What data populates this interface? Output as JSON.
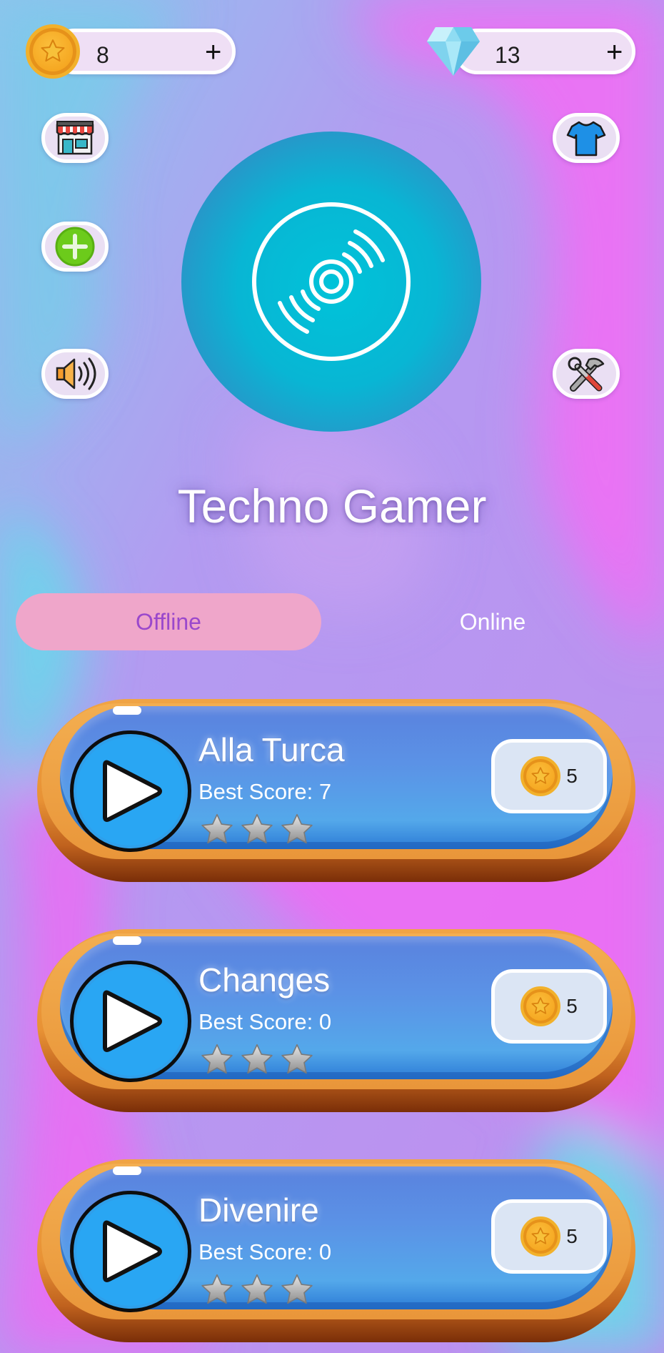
{
  "currency": {
    "coins": {
      "value": "8",
      "add_label": "+"
    },
    "gems": {
      "value": "13",
      "add_label": "+"
    }
  },
  "side_buttons": {
    "left": [
      "shop-icon",
      "add-icon",
      "speaker-icon"
    ],
    "right": [
      "shirt-icon",
      "tools-icon"
    ]
  },
  "player_name": "Techno Gamer",
  "tabs": [
    {
      "label": "Offline",
      "active": true
    },
    {
      "label": "Online",
      "active": false
    }
  ],
  "songs": [
    {
      "name": "Alla Turca",
      "best_score": "Best Score: 7",
      "cost": "5",
      "stars_earned": 0,
      "stars_total": 3
    },
    {
      "name": "Changes",
      "best_score": "Best Score: 0",
      "cost": "5",
      "stars_earned": 0,
      "stars_total": 3
    },
    {
      "name": "Divenire",
      "best_score": "Best Score: 0",
      "cost": "5",
      "stars_earned": 0,
      "stars_total": 3
    }
  ],
  "colors": {
    "accent_pink": "#efa6ca",
    "active_tab_text": "#9a48cc",
    "card_blue": "#5b92e6",
    "wood": "#e89235",
    "play_blue": "#29a6f3",
    "coin_gold": "#f5a51f"
  }
}
